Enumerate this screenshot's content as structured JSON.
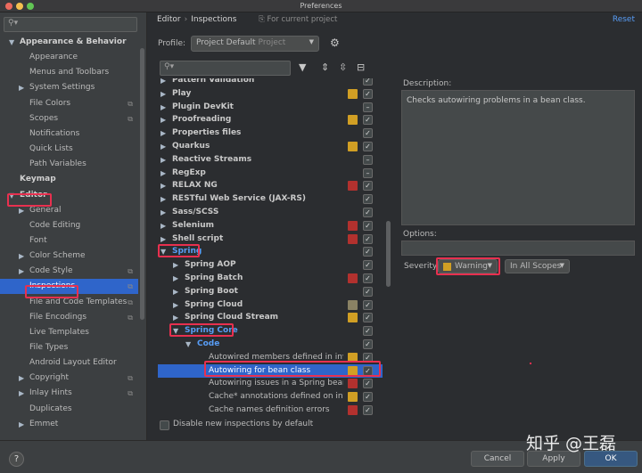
{
  "window": {
    "title": "Preferences"
  },
  "sidebar": {
    "items": [
      {
        "label": "Appearance & Behavior",
        "bold": true,
        "arrow": "▼"
      },
      {
        "label": "Appearance"
      },
      {
        "label": "Menus and Toolbars"
      },
      {
        "label": "System Settings",
        "arrow": "▶"
      },
      {
        "label": "File Colors",
        "icon": true
      },
      {
        "label": "Scopes",
        "icon": true
      },
      {
        "label": "Notifications"
      },
      {
        "label": "Quick Lists"
      },
      {
        "label": "Path Variables"
      },
      {
        "label": "Keymap",
        "bold": true
      },
      {
        "label": "Editor",
        "bold": true,
        "arrow": "▼"
      },
      {
        "label": "General",
        "arrow": "▶"
      },
      {
        "label": "Code Editing"
      },
      {
        "label": "Font"
      },
      {
        "label": "Color Scheme",
        "arrow": "▶"
      },
      {
        "label": "Code Style",
        "arrow": "▶",
        "icon": true
      },
      {
        "label": "Inspections",
        "selected": true,
        "icon": true
      },
      {
        "label": "File and Code Templates",
        "icon": true
      },
      {
        "label": "File Encodings",
        "icon": true
      },
      {
        "label": "Live Templates"
      },
      {
        "label": "File Types"
      },
      {
        "label": "Android Layout Editor"
      },
      {
        "label": "Copyright",
        "arrow": "▶",
        "icon": true
      },
      {
        "label": "Inlay Hints",
        "arrow": "▶",
        "icon": true
      },
      {
        "label": "Duplicates"
      },
      {
        "label": "Emmet",
        "arrow": "▶"
      }
    ]
  },
  "header": {
    "breadcrumb_root": "Editor",
    "breadcrumb_sep": "›",
    "breadcrumb_page": "Inspections",
    "scope_note": "For current project",
    "reset": "Reset"
  },
  "profile": {
    "label": "Profile:",
    "value": "Project Default",
    "kind": "Project"
  },
  "tree": {
    "rows": [
      {
        "label": "Pattern Validation",
        "arrow": "▶",
        "check": "✓"
      },
      {
        "label": "Play",
        "arrow": "▶",
        "sev": "#d19f24",
        "check": "✓"
      },
      {
        "label": "Plugin DevKit",
        "arrow": "▶",
        "check": "–"
      },
      {
        "label": "Proofreading",
        "arrow": "▶",
        "sev": "#d19f24",
        "check": "✓"
      },
      {
        "label": "Properties files",
        "arrow": "▶",
        "check": "✓"
      },
      {
        "label": "Quarkus",
        "arrow": "▶",
        "sev": "#d19f24",
        "check": "✓"
      },
      {
        "label": "Reactive Streams",
        "arrow": "▶",
        "check": "–"
      },
      {
        "label": "RegExp",
        "arrow": "▶",
        "check": "–"
      },
      {
        "label": "RELAX NG",
        "arrow": "▶",
        "sev": "#b2312e",
        "check": "✓"
      },
      {
        "label": "RESTful Web Service (JAX-RS)",
        "arrow": "▶",
        "check": "✓"
      },
      {
        "label": "Sass/SCSS",
        "arrow": "▶",
        "check": "✓"
      },
      {
        "label": "Selenium",
        "arrow": "▶",
        "sev": "#b2312e",
        "check": "✓"
      },
      {
        "label": "Shell script",
        "arrow": "▶",
        "sev": "#b2312e",
        "check": "✓"
      },
      {
        "label": "Spring",
        "arrow": "▼",
        "blue": true,
        "check": "✓"
      },
      {
        "label": "Spring AOP",
        "arrow": "▶",
        "indent": 1,
        "check": "✓"
      },
      {
        "label": "Spring Batch",
        "arrow": "▶",
        "indent": 1,
        "sev": "#b2312e",
        "check": "✓"
      },
      {
        "label": "Spring Boot",
        "arrow": "▶",
        "indent": 1,
        "check": "✓"
      },
      {
        "label": "Spring Cloud",
        "arrow": "▶",
        "indent": 1,
        "sev": "#8a8264",
        "check": "✓"
      },
      {
        "label": "Spring Cloud Stream",
        "arrow": "▶",
        "indent": 1,
        "sev": "#d19f24",
        "check": "✓"
      },
      {
        "label": "Spring Core",
        "arrow": "▼",
        "indent": 1,
        "blue": true,
        "check": "✓"
      },
      {
        "label": "Code",
        "arrow": "▼",
        "indent": 2,
        "blue": true,
        "check": "✓"
      },
      {
        "label": "Autowired members defined in invalid Spring bean",
        "indent": 3,
        "leaf": true,
        "sev": "#d19f24",
        "check": "✓"
      },
      {
        "label": "Autowiring for bean class",
        "indent": 3,
        "leaf": true,
        "selected": true,
        "sev": "#d19f24",
        "check": "✓"
      },
      {
        "label": "Autowiring issues in a Spring bean class",
        "indent": 3,
        "leaf": true,
        "sev": "#b2312e",
        "check": "✓"
      },
      {
        "label": "Cache* annotations defined on interface/interface method",
        "indent": 3,
        "leaf": true,
        "sev": "#d19f24",
        "check": "✓"
      },
      {
        "label": "Cache names definition errors",
        "indent": 3,
        "leaf": true,
        "sev": "#b2312e",
        "check": "✓"
      }
    ]
  },
  "disable_new": {
    "label": "Disable new inspections by default"
  },
  "description": {
    "label": "Description:",
    "text": "Checks autowiring problems in a bean class.",
    "options_label": "Options:"
  },
  "severity": {
    "label": "Severity:",
    "value": "Warning",
    "scope": "In All Scopes"
  },
  "buttons": {
    "help": "?",
    "cancel": "Cancel",
    "apply": "Apply",
    "ok": "OK"
  },
  "watermark": "知乎 @王磊"
}
